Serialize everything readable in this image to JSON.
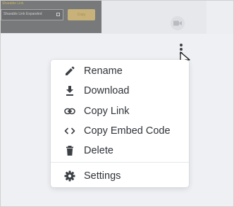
{
  "background": {
    "thumbnail": {
      "caption": "Sharable Link",
      "link_field_value": "Sharable Link Expanded",
      "button_label": "Copy"
    },
    "icons": {
      "video": "video-camera-icon",
      "more": "more-vertical-icon"
    }
  },
  "menu": {
    "items": [
      {
        "label": "Rename",
        "icon": "pencil-icon"
      },
      {
        "label": "Download",
        "icon": "download-icon"
      },
      {
        "label": "Copy Link",
        "icon": "link-icon"
      },
      {
        "label": "Copy Embed Code",
        "icon": "code-icon"
      },
      {
        "label": "Delete",
        "icon": "trash-icon"
      },
      {
        "label": "Settings",
        "icon": "gear-icon"
      }
    ]
  },
  "colors": {
    "menu_text": "#2f3338",
    "icon": "#3c3f44",
    "page_background": "#eef0f4"
  }
}
